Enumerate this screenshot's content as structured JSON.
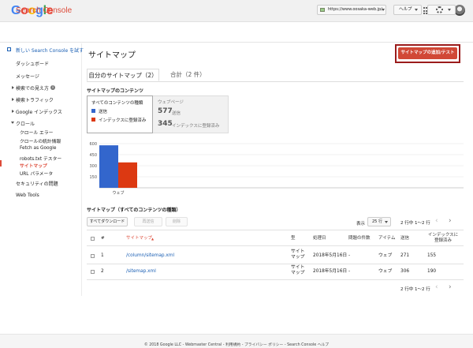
{
  "header": {
    "logo_letters": [
      "G",
      "o",
      "o",
      "g",
      "l",
      "e"
    ],
    "logo_colors": [
      "#4285f4",
      "#ea4335",
      "#fbbc05",
      "#4285f4",
      "#34a853",
      "#ea4335"
    ]
  },
  "sc_header": {
    "brand": "Search Console",
    "site": "https://www.oosaka-web.jp/",
    "help_label": "ヘルプ"
  },
  "sidebar": {
    "new_sc": "新しい Search Console を試す",
    "items": [
      "ダッシュボード",
      "メッセージ",
      "検索での見え方",
      "検索トラフィック",
      "Google インデックス",
      "クロール",
      "クロール エラー",
      "クロールの統計情報",
      "Fetch as Google",
      "robots.txt テスター",
      "サイトマップ",
      "URL パラメータ",
      "セキュリティの問題",
      "Web Tools"
    ],
    "info_glyph": "i"
  },
  "main": {
    "title": "サイトマップ",
    "add_button": "サイトマップの追加/テスト",
    "tabs": [
      "自分のサイトマップ（2）",
      "合計（2 件）"
    ],
    "contents_title": "サイトマップのコンテンツ",
    "legend": {
      "heading": "すべてのコンテンツの種類",
      "submitted": "送信",
      "indexed": "インデックスに登録済み"
    },
    "stats": {
      "heading": "ウェブページ",
      "submitted_value": "577",
      "submitted_label": "送信",
      "indexed_value": "345",
      "indexed_label": "インデックスに登録済み"
    }
  },
  "chart_data": {
    "type": "bar",
    "categories": [
      "ウェブ"
    ],
    "series": [
      {
        "name": "送信",
        "values": [
          577
        ],
        "color": "#3366cc"
      },
      {
        "name": "インデックスに登録済み",
        "values": [
          345
        ],
        "color": "#dc3912"
      }
    ],
    "yticks": [
      150,
      300,
      450,
      600
    ],
    "ylim": [
      0,
      600
    ],
    "grid": true
  },
  "table": {
    "title": "サイトマップ（すべてのコンテンツの種類）",
    "buttons": {
      "download": "すべてダウンロード",
      "resubmit": "再送信",
      "delete": "削除"
    },
    "show_label": "表示",
    "page_size": "25 行",
    "pagination": "2 行中 1〜2 行",
    "prev_glyph": "‹",
    "next_glyph": "›",
    "sort_glyph": "▲",
    "headers": {
      "num": "#",
      "sitemap": "サイトマップ",
      "type": "型",
      "processed": "処理日",
      "issues": "問題の件数",
      "item": "アイテム",
      "submitted": "送信",
      "indexed": "インデックスに登録済み"
    },
    "rows": [
      {
        "num": "1",
        "path": "/column/sitemap.xml",
        "type": "サイトマップ",
        "processed": "2018年5月16日",
        "issues": "-",
        "item": "ウェブ",
        "submitted": "271",
        "indexed": "155"
      },
      {
        "num": "2",
        "path": "/sitemap.xml",
        "type": "サイトマップ",
        "processed": "2018年5月16日",
        "issues": "-",
        "item": "ウェブ",
        "submitted": "306",
        "indexed": "190"
      }
    ]
  },
  "footer": {
    "text": "© 2018 Google LLC - Webmaster Central - 利用規約 - プライバシー ポリシー - Search Console ヘルプ"
  }
}
